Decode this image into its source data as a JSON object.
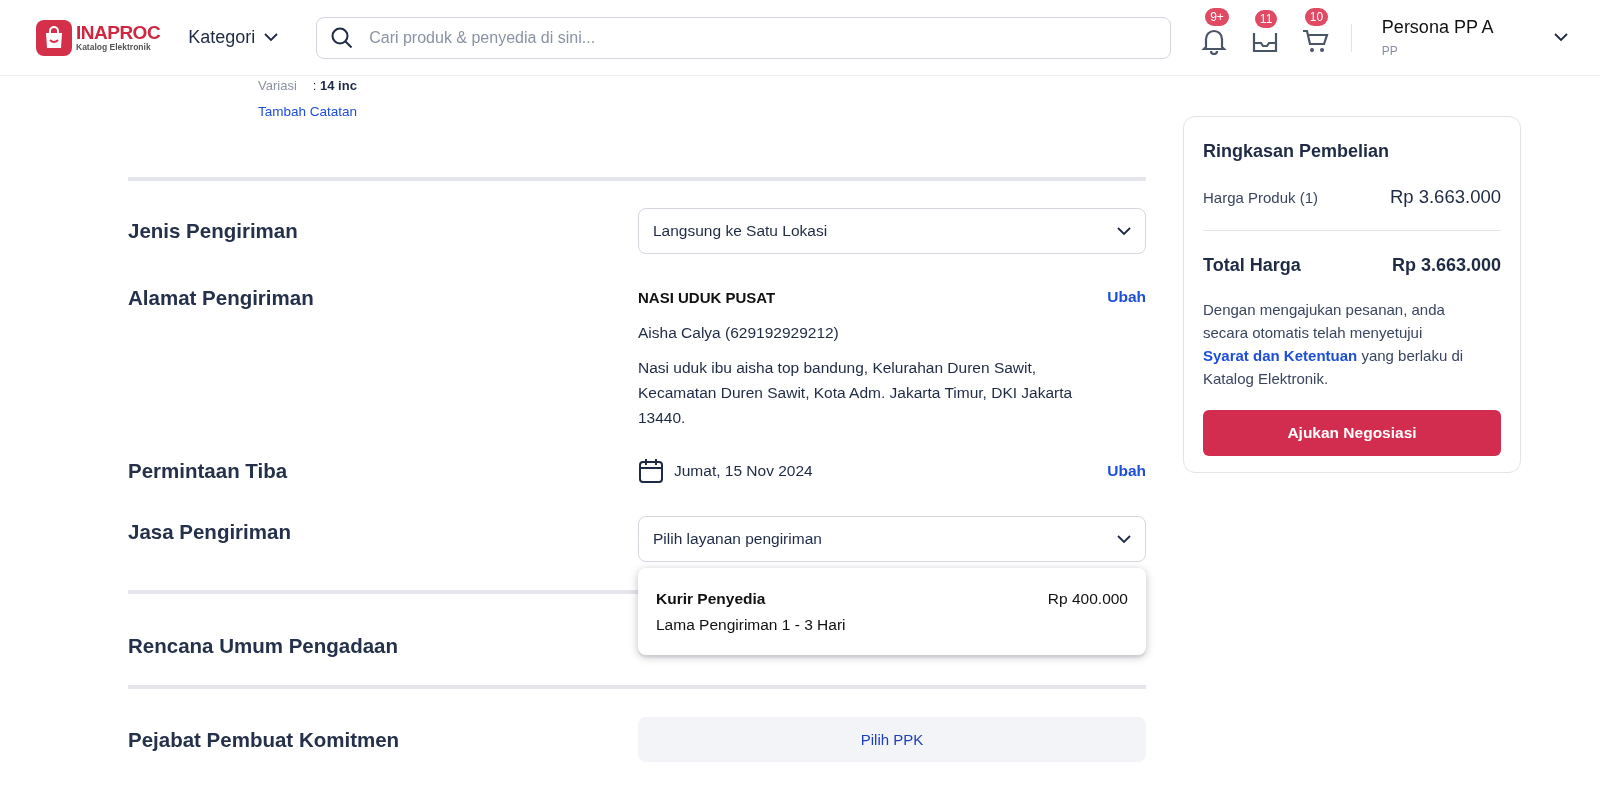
{
  "header": {
    "logo_title": "INAPROC",
    "logo_subtitle": "Katalog Elektronik",
    "category": "Kategori",
    "search": {
      "placeholder": "Cari produk & penyedia di sini..."
    },
    "badges": [
      {
        "kind": "bell",
        "count": "9+"
      },
      {
        "kind": "inbox",
        "count": "11"
      },
      {
        "kind": "cart",
        "count": "10"
      }
    ],
    "user": {
      "name": "Persona PP A",
      "role": "PP"
    }
  },
  "product": {
    "variation_label": "Variasi",
    "variation_value": ": **14 inc**",
    "add_note": "Tambah Catatan"
  },
  "shipping": {
    "type_label": "Jenis Pengiriman",
    "type_value": "Langsung ke Satu Lokasi",
    "address_label": "Alamat Pengiriman",
    "address_name": "NASI UDUK PUSAT",
    "address_edit": "Ubah",
    "recipient": "Aisha Calya (629192929212)",
    "address": "Nasi uduk ibu aisha top bandung, Kelurahan Duren Sawit, Kecamatan Duren Sawit, Kota Adm. Jakarta Timur, DKI Jakarta 13440.",
    "arrival_label": "Permintaan Tiba",
    "arrival_date": "Jumat, 15 Nov 2024",
    "arrival_edit": "Ubah",
    "service_label": "Jasa Pengiriman",
    "service_placeholder": "Pilih layanan pengiriman",
    "service_options": [
      {
        "name": "Kurir Penyedia",
        "duration": "Lama Pengiriman 1 - 3 Hari",
        "price": "Rp 400.000"
      }
    ]
  },
  "rup": {
    "label": "Rencana Umum Pengadaan"
  },
  "ppk": {
    "label": "Pejabat Pembuat Komitmen",
    "button": "Pilih PPK"
  },
  "summary": {
    "title": "Ringkasan Pembelian",
    "product_label": "Harga Produk (1)",
    "product_price": "Rp 3.663.000",
    "total_label": "Total Harga",
    "total_price": "Rp 3.663.000",
    "terms": "Dengan mengajukan pesanan, anda secara otomatis telah menyetujui",
    "terms_link": "Syarat dan Ketentuan",
    "terms_end": "yang berlaku di Katalog Elektronik.",
    "button": "Ajukan Negosiasi"
  }
}
